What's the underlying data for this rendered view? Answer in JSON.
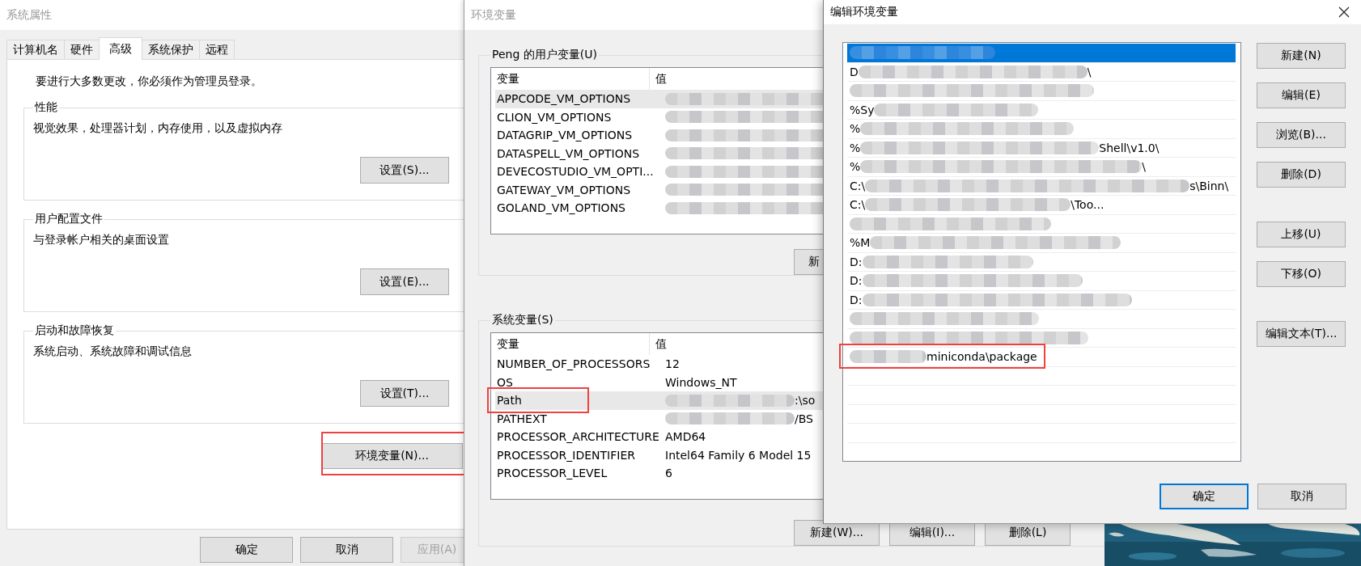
{
  "system_properties": {
    "title": "系统属性",
    "tabs": [
      {
        "label": "计算机名",
        "selected": false
      },
      {
        "label": "硬件",
        "selected": false
      },
      {
        "label": "高级",
        "selected": true
      },
      {
        "label": "系统保护",
        "selected": false
      },
      {
        "label": "远程",
        "selected": false
      }
    ],
    "notice": "要进行大多数更改，你必须作为管理员登录。",
    "groups": [
      {
        "label": "性能",
        "description": "视觉效果，处理器计划，内存使用，以及虚拟内存",
        "button": "设置(S)..."
      },
      {
        "label": "用户配置文件",
        "description": "与登录帐户相关的桌面设置",
        "button": "设置(E)..."
      },
      {
        "label": "启动和故障恢复",
        "description": "系统启动、系统故障和调试信息",
        "button": "设置(T)..."
      }
    ],
    "env_button": {
      "label": "环境变量(N)...",
      "highlighted": true
    },
    "footer_buttons": [
      {
        "label": "确定",
        "disabled": false
      },
      {
        "label": "取消",
        "disabled": false
      },
      {
        "label": "应用(A)",
        "disabled": true
      }
    ]
  },
  "environment_variables": {
    "title": "环境变量",
    "user_group": {
      "label": "Peng 的用户变量(U)",
      "columns": [
        "变量",
        "值"
      ],
      "rows": [
        {
          "name": "APPCODE_VM_OPTIONS",
          "selected": true,
          "redacted": true,
          "highlighted": false
        },
        {
          "name": "CLION_VM_OPTIONS",
          "selected": false,
          "redacted": true,
          "highlighted": false
        },
        {
          "name": "DATAGRIP_VM_OPTIONS",
          "selected": false,
          "redacted": true,
          "highlighted": false
        },
        {
          "name": "DATASPELL_VM_OPTIONS",
          "selected": false,
          "redacted": true,
          "highlighted": false
        },
        {
          "name": "DEVECOSTUDIO_VM_OPTI...",
          "selected": false,
          "redacted": true,
          "highlighted": false
        },
        {
          "name": "GATEWAY_VM_OPTIONS",
          "selected": false,
          "redacted": true,
          "highlighted": false
        },
        {
          "name": "GOLAND_VM_OPTIONS",
          "selected": false,
          "redacted": true,
          "highlighted": false
        }
      ],
      "buttons": [
        "新"
      ]
    },
    "system_group": {
      "label": "系统变量(S)",
      "columns": [
        "变量",
        "值"
      ],
      "rows": [
        {
          "name": "NUMBER_OF_PROCESSORS",
          "value": "12",
          "selected": false,
          "redacted": false,
          "highlighted": false
        },
        {
          "name": "OS",
          "value": "Windows_NT",
          "selected": false,
          "redacted": false,
          "highlighted": false
        },
        {
          "name": "Path",
          "value": ":\\so",
          "selected": true,
          "redacted": true,
          "highlighted": true
        },
        {
          "name": "PATHEXT",
          "value": "/BS",
          "selected": false,
          "redacted": true,
          "highlighted": false
        },
        {
          "name": "PROCESSOR_ARCHITECTURE",
          "value": "AMD64",
          "selected": false,
          "redacted": false,
          "highlighted": false
        },
        {
          "name": "PROCESSOR_IDENTIFIER",
          "value": "Intel64 Family 6 Model 15",
          "selected": false,
          "redacted": false,
          "highlighted": false
        },
        {
          "name": "PROCESSOR_LEVEL",
          "value": "6",
          "selected": false,
          "redacted": false,
          "highlighted": false
        }
      ],
      "buttons": [
        "新建(W)...",
        "编辑(I)...",
        "删除(L)"
      ]
    }
  },
  "edit_environment_variable": {
    "title": "编辑环境变量",
    "entries": [
      {
        "selected": true,
        "redacted": true,
        "highlighted": false
      },
      {
        "prefix": "D",
        "suffix": "\\",
        "selected": false,
        "redacted": true,
        "highlighted": false
      },
      {
        "selected": false,
        "redacted": true,
        "highlighted": false
      },
      {
        "prefix": "%Sy",
        "selected": false,
        "redacted": true,
        "highlighted": false
      },
      {
        "prefix": "%",
        "selected": false,
        "redacted": true,
        "highlighted": false
      },
      {
        "prefix": "%",
        "suffix": "Shell\\v1.0\\",
        "selected": false,
        "redacted": true,
        "highlighted": false
      },
      {
        "prefix": "%",
        "suffix": "\\",
        "selected": false,
        "redacted": true,
        "highlighted": false
      },
      {
        "prefix": "C:\\",
        "suffix": "s\\Binn\\",
        "selected": false,
        "redacted": true,
        "highlighted": false
      },
      {
        "prefix": "C:\\",
        "suffix": "\\Too...",
        "selected": false,
        "redacted": true,
        "highlighted": false
      },
      {
        "selected": false,
        "redacted": true,
        "highlighted": false
      },
      {
        "prefix": "%M",
        "selected": false,
        "redacted": true,
        "highlighted": false
      },
      {
        "prefix": "D:",
        "selected": false,
        "redacted": true,
        "highlighted": false
      },
      {
        "prefix": "D:",
        "selected": false,
        "redacted": true,
        "highlighted": false
      },
      {
        "prefix": "D:",
        "selected": false,
        "redacted": true,
        "highlighted": false
      },
      {
        "selected": false,
        "redacted": true,
        "highlighted": false
      },
      {
        "selected": false,
        "redacted": true,
        "highlighted": false
      },
      {
        "suffix": "miniconda\\package",
        "selected": false,
        "redacted": true,
        "highlighted": true
      }
    ],
    "side_button_groups": [
      [
        "新建(N)",
        "编辑(E)",
        "浏览(B)...",
        "删除(D)"
      ],
      [
        "上移(U)",
        "下移(O)"
      ],
      [
        "编辑文本(T)..."
      ]
    ],
    "footer_buttons": [
      {
        "label": "确定",
        "default": true
      },
      {
        "label": "取消",
        "default": false
      }
    ]
  }
}
